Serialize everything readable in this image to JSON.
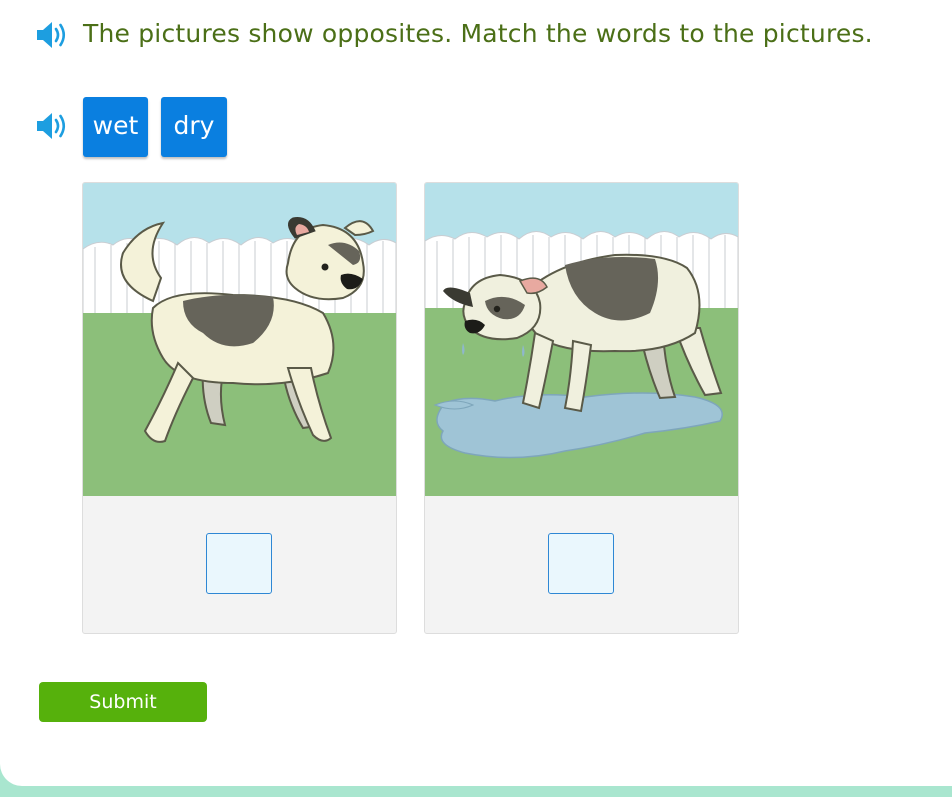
{
  "question": {
    "text": "The pictures show opposites. Match the words to the pictures.",
    "audio_icon": "speaker-icon"
  },
  "word_bank": {
    "audio_icon": "speaker-icon",
    "tiles": [
      {
        "label": "wet"
      },
      {
        "label": "dry"
      }
    ]
  },
  "pictures": [
    {
      "depicts": "dog-standing-on-grass",
      "answer": ""
    },
    {
      "depicts": "soaked-dog-standing-in-puddle",
      "answer": ""
    }
  ],
  "submit": {
    "label": "Submit"
  },
  "colors": {
    "question_text": "#4b6f17",
    "tile": "#0a7fe0",
    "drop_zone_border": "#2e87d4",
    "submit": "#56b10c",
    "footer": "#a9e6cf"
  }
}
